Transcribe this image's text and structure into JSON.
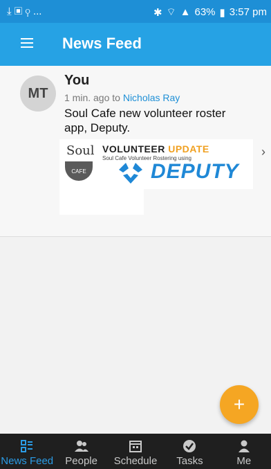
{
  "statusbar": {
    "left_icons": "⤓ ▣ ⚲ ...",
    "battery": "63%",
    "time": "3:57 pm"
  },
  "appbar": {
    "title": "News Feed"
  },
  "post": {
    "initials": "MT",
    "author": "You",
    "time_text": "1 min. ago to",
    "recipient": "Nicholas Ray",
    "message": "Soul Cafe new volunteer roster app, Deputy.",
    "attachment": {
      "soul": "Soul",
      "cafe": "CAFE",
      "vu_title_a": "VOLUNTEER",
      "vu_title_b": "UPDATE",
      "vu_sub": "Soul Cafe Volunteer Rostering using",
      "brand": "DEPUTY"
    }
  },
  "fab": {
    "label": "+"
  },
  "nav": {
    "items": [
      "News Feed",
      "People",
      "Schedule",
      "Tasks",
      "Me"
    ]
  },
  "colors": {
    "primary": "#26a2e4",
    "accent": "#f5a623",
    "nav_bg": "#1f1f1f"
  }
}
